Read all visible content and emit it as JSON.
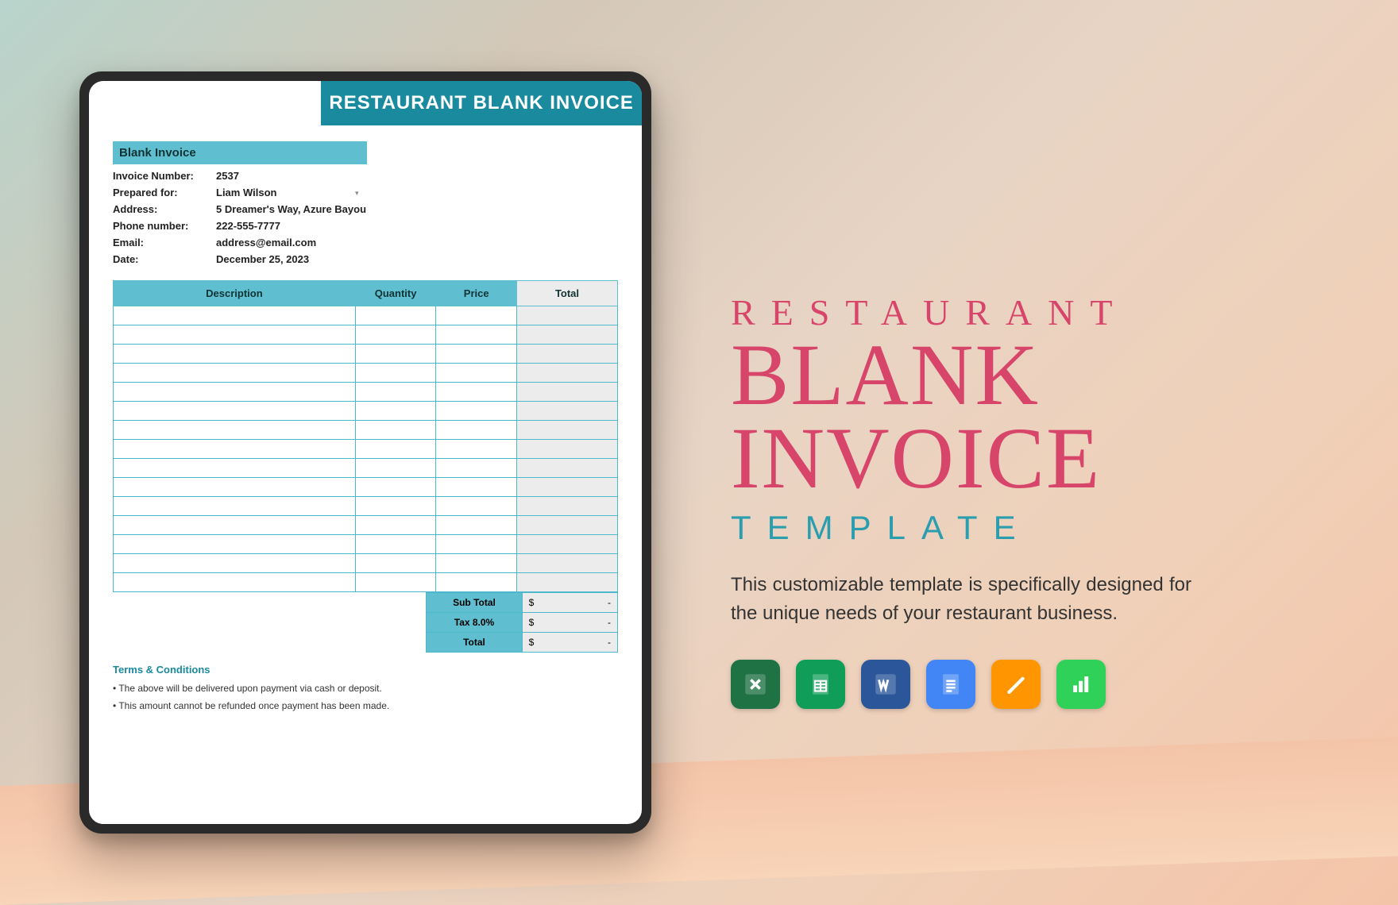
{
  "banner": "RESTAURANT BLANK INVOICE",
  "invoice": {
    "section_title": "Blank Invoice",
    "fields": [
      {
        "label": "Invoice Number:",
        "value": "2537"
      },
      {
        "label": "Prepared for:",
        "value": "Liam Wilson",
        "dropdown": true
      },
      {
        "label": "Address:",
        "value": "5 Dreamer's Way, Azure Bayou"
      },
      {
        "label": "Phone number:",
        "value": "222-555-7777"
      },
      {
        "label": "Email:",
        "value": "address@email.com"
      },
      {
        "label": "Date:",
        "value": "December 25, 2023"
      }
    ],
    "columns": [
      "Description",
      "Quantity",
      "Price",
      "Total"
    ],
    "blank_rows": 15,
    "summary": [
      {
        "label": "Sub Total",
        "currency": "$",
        "value": "-"
      },
      {
        "label": "Tax  8.0%",
        "currency": "$",
        "value": "-"
      },
      {
        "label": "Total",
        "currency": "$",
        "value": "-"
      }
    ],
    "terms_heading": "Terms & Conditions",
    "terms": [
      "• The above will be delivered upon payment via cash or deposit.",
      "• This amount cannot be refunded once payment has been made."
    ]
  },
  "promo": {
    "line1": "RESTAURANT",
    "line2": "BLANK",
    "line3": "INVOICE",
    "line4": "TEMPLATE",
    "description": "This customizable template is specifically designed for the unique needs of your restaurant business."
  },
  "apps": [
    {
      "name": "excel-icon"
    },
    {
      "name": "google-sheets-icon"
    },
    {
      "name": "word-icon"
    },
    {
      "name": "google-docs-icon"
    },
    {
      "name": "apple-pages-icon"
    },
    {
      "name": "apple-numbers-icon"
    }
  ]
}
